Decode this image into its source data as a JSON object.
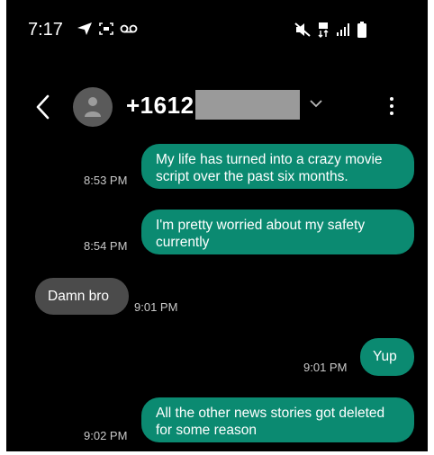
{
  "status_bar": {
    "time": "7:17"
  },
  "header": {
    "contact": "+1612"
  },
  "messages": [
    {
      "dir": "out",
      "text": "My life has turned into a crazy movie script over the past six months.",
      "time": "8:53 PM"
    },
    {
      "dir": "out",
      "text": "I'm pretty worried about my safety currently",
      "time": "8:54 PM"
    },
    {
      "dir": "in",
      "text": "Damn bro",
      "time": "9:01 PM"
    },
    {
      "dir": "out",
      "text": "Yup",
      "time": "9:01 PM"
    },
    {
      "dir": "out",
      "text": "All the other news stories got deleted for some reason",
      "time": "9:02 PM"
    }
  ],
  "colors": {
    "sent": "#0b8a71",
    "received": "#4b4b4b",
    "background": "#000000"
  },
  "icons": [
    "send-arrow-icon",
    "screenshot-icon",
    "voicemail-icon",
    "mute-icon",
    "data-icon",
    "signal-icon",
    "battery-icon",
    "back-icon",
    "person-icon",
    "chevron-down-icon",
    "more-options-icon"
  ]
}
